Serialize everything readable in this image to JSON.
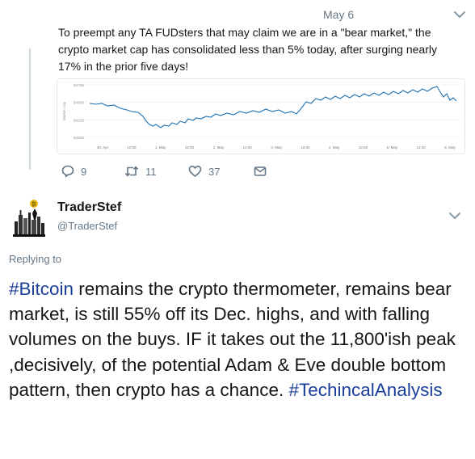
{
  "previous_tweet": {
    "date": "May 6",
    "text": "To preempt any TA FUDsters that may claim we are in a \"bear market,\" the crypto market cap has consolidated less than 5% today, after surging nearly 17% in the prior five days!",
    "actions": {
      "replies": "9",
      "retweets": "11",
      "likes": "37"
    },
    "chart": {
      "y_tick_labels": [
        "$475B",
        "$450B",
        "$425B",
        "$400B"
      ],
      "y_axis_label": "Market Cap",
      "x_tick_labels": [
        "30. Apr",
        "12:00",
        "1. May",
        "12:00",
        "2. May",
        "12:00",
        "3. May",
        "12:00",
        "4. May",
        "12:00",
        "5. May",
        "12:00",
        "6. May"
      ],
      "line_color": "#1a6fb3"
    }
  },
  "reply_tweet": {
    "display_name": "TraderStef",
    "handle": "@TraderStef",
    "replying_to_label": "Replying to",
    "text_parts": [
      {
        "type": "hashtag",
        "text": "#Bitcoin"
      },
      {
        "type": "text",
        "text": " remains the crypto thermometer, remains bear market, is still 55% off its Dec. highs, and with falling volumes on the buys. IF it takes out the 11,800'ish peak ,decisively, of the potential Adam & Eve double bottom pattern, then crypto has a chance. "
      },
      {
        "type": "hashtag",
        "text": "#TechincalAnalysis"
      }
    ],
    "hashtag_color": "#1b3f99"
  },
  "icons": {
    "caret": "chevron-down-icon",
    "reply": "reply-bubble-icon",
    "retweet": "retweet-icon",
    "like": "heart-icon",
    "dm": "envelope-icon"
  }
}
